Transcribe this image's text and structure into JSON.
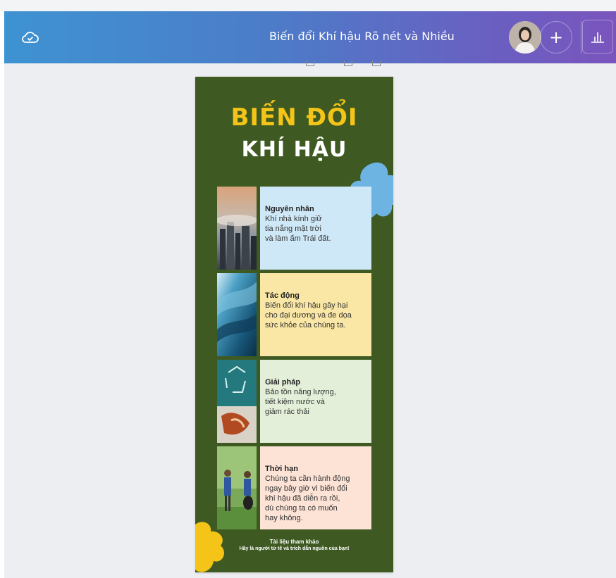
{
  "header": {
    "title": "Biến đổi Khí hậu Rõ nét và Nhiều",
    "plus_label": "+",
    "cloud_icon": "cloud-check-icon",
    "chart_icon": "bar-chart-icon"
  },
  "poster": {
    "title_line1": "BIẾN ĐỔI",
    "title_line2": "KHÍ HẬU",
    "background": "#3e5a22",
    "accent": "#f4c518",
    "cards": [
      {
        "title": "Nguyên nhân",
        "text": "Khí nhà kính giữ\ntia nắng mặt trời\nvà làm ấm Trái đất.",
        "color": "#cfe8f7",
        "photo": "city-smog-photo"
      },
      {
        "title": "Tác động",
        "text": "Biến đổi khí hậu gây hại\ncho đại dương và đe dọa\nsức khỏe của chúng ta.",
        "color": "#fae7a5",
        "photo": "ocean-wave-photo"
      },
      {
        "title": "Giải pháp",
        "text": "Bảo tồn năng lượng,\ntiết kiệm nước và\ngiảm rác thải",
        "color": "#e3efd9",
        "photo": "recycling-photo"
      },
      {
        "title": "Thời hạn",
        "text": "Chúng ta cần hành động\nngay bây giờ vì biến đổi\nkhí hậu đã diễn ra rồi,\ndù chúng ta có muốn\nhay không.",
        "color": "#fce3d6",
        "photo": "volunteers-photo"
      }
    ],
    "references_title": "Tài liệu tham khảo",
    "references_text": "Hãy là người tử tế và trích dẫn nguồn của bạn!"
  }
}
